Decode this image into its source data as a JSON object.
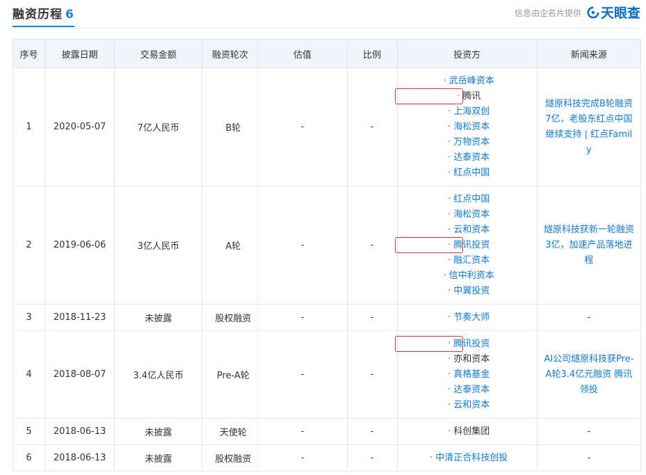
{
  "header": {
    "title": "融资历程",
    "count": "6",
    "provider_text": "信息由企名片提供",
    "logo_text": "天眼查",
    "logo_icon": "tianyancha-logo-icon",
    "accent": "#1585e5"
  },
  "table": {
    "columns": [
      "序号",
      "披露日期",
      "交易金额",
      "融资轮次",
      "估值",
      "比例",
      "投资方",
      "新闻来源"
    ],
    "rows": [
      {
        "seq": "1",
        "date": "2020-05-07",
        "amount": "7亿人民币",
        "round": "B轮",
        "valuation": "-",
        "ratio": "-",
        "investors": [
          {
            "name": "武岳峰资本",
            "link": true,
            "highlight": false
          },
          {
            "name": "腾讯",
            "link": false,
            "highlight": true
          },
          {
            "name": "上海双创",
            "link": true,
            "highlight": false
          },
          {
            "name": "海松资本",
            "link": true,
            "highlight": false
          },
          {
            "name": "万物资本",
            "link": true,
            "highlight": false
          },
          {
            "name": "达泰资本",
            "link": true,
            "highlight": false
          },
          {
            "name": "红点中国",
            "link": true,
            "highlight": false
          }
        ],
        "news": "燧原科技完成B轮融资7亿，老股东红点中国继续支持 | 红点Family"
      },
      {
        "seq": "2",
        "date": "2019-06-06",
        "amount": "3亿人民币",
        "round": "A轮",
        "valuation": "-",
        "ratio": "-",
        "investors": [
          {
            "name": "红点中国",
            "link": true,
            "highlight": false
          },
          {
            "name": "海松资本",
            "link": true,
            "highlight": false
          },
          {
            "name": "云和资本",
            "link": true,
            "highlight": false
          },
          {
            "name": "腾讯投资",
            "link": true,
            "highlight": true
          },
          {
            "name": "融汇资本",
            "link": true,
            "highlight": false
          },
          {
            "name": "信中利资本",
            "link": true,
            "highlight": false
          },
          {
            "name": "中冀投资",
            "link": true,
            "highlight": false
          }
        ],
        "news": "燧原科技获新一轮融资3亿，加速产品落地进程"
      },
      {
        "seq": "3",
        "date": "2018-11-23",
        "amount": "未披露",
        "round": "股权融资",
        "valuation": "-",
        "ratio": "-",
        "investors": [
          {
            "name": "节奏大师",
            "link": true,
            "highlight": false
          }
        ],
        "news": "-"
      },
      {
        "seq": "4",
        "date": "2018-08-07",
        "amount": "3.4亿人民币",
        "round": "Pre-A轮",
        "valuation": "-",
        "ratio": "-",
        "investors": [
          {
            "name": "腾讯投资",
            "link": true,
            "highlight": true
          },
          {
            "name": "亦和资本",
            "link": false,
            "highlight": false
          },
          {
            "name": "真格基金",
            "link": true,
            "highlight": false
          },
          {
            "name": "达泰资本",
            "link": true,
            "highlight": false
          },
          {
            "name": "云和资本",
            "link": true,
            "highlight": false
          }
        ],
        "news": "AI公司燧原科技获Pre-A轮3.4亿元融资 腾讯领投"
      },
      {
        "seq": "5",
        "date": "2018-06-13",
        "amount": "未披露",
        "round": "天使轮",
        "valuation": "-",
        "ratio": "-",
        "investors": [
          {
            "name": "科创集团",
            "link": false,
            "highlight": false
          }
        ],
        "news": "-"
      },
      {
        "seq": "6",
        "date": "2018-06-13",
        "amount": "未披露",
        "round": "股权融资",
        "valuation": "-",
        "ratio": "-",
        "investors": [
          {
            "name": "中清正合科技创投",
            "link": true,
            "highlight": false
          }
        ],
        "news": "-"
      }
    ]
  }
}
